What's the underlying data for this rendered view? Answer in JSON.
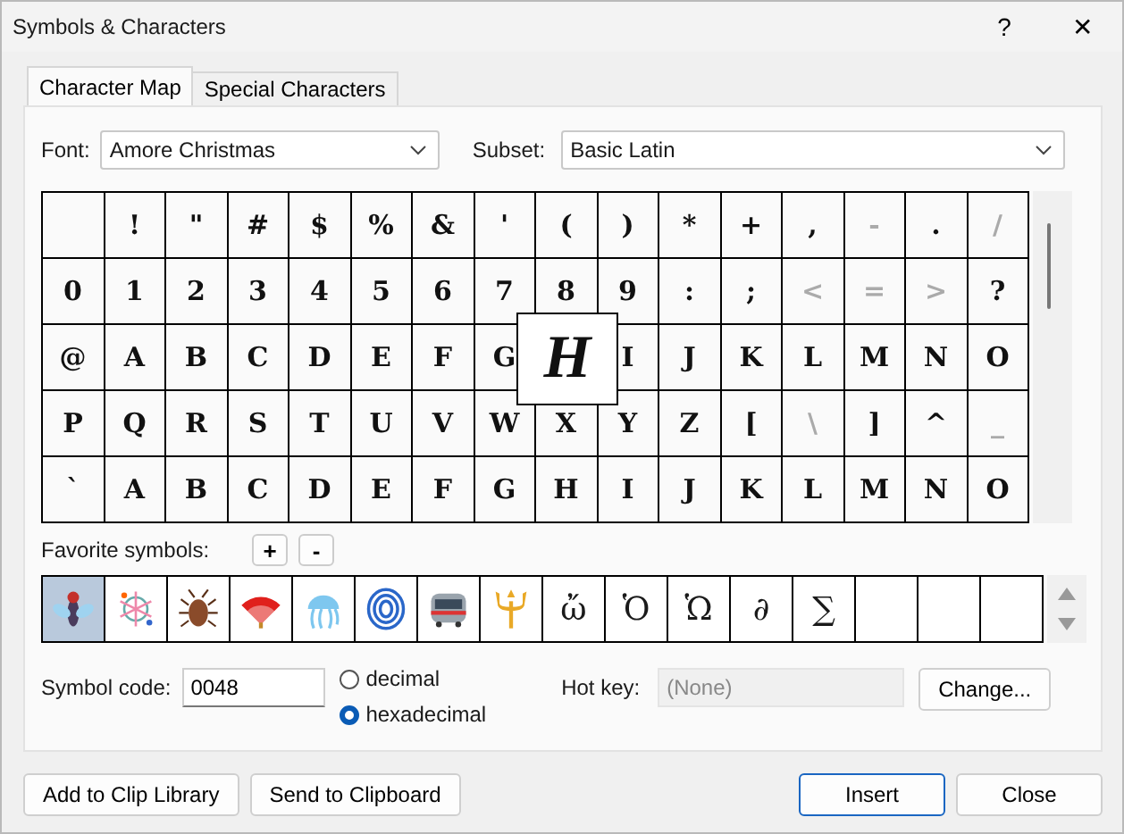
{
  "window": {
    "title": "Symbols & Characters",
    "help": "?",
    "close": "✕"
  },
  "tabs": [
    {
      "label": "Character Map",
      "selected": true
    },
    {
      "label": "Special Characters",
      "selected": false
    }
  ],
  "font": {
    "label": "Font:",
    "value": "Amore Christmas"
  },
  "subset": {
    "label": "Subset:",
    "value": "Basic Latin"
  },
  "grid": {
    "rows": [
      [
        " ",
        "!",
        "\"",
        "#",
        "$",
        "%",
        "&",
        "'",
        "(",
        ")",
        "*",
        "+",
        ",",
        {
          "text": "-",
          "faint": true
        },
        ".",
        {
          "text": "/",
          "faint": true
        }
      ],
      [
        "0",
        "1",
        "2",
        "3",
        "4",
        "5",
        "6",
        "7",
        "8",
        "9",
        ":",
        ";",
        {
          "text": "<",
          "faint": true
        },
        {
          "text": "=",
          "faint": true
        },
        {
          "text": ">",
          "faint": true
        },
        "?"
      ],
      [
        "@",
        "A",
        "B",
        "C",
        "D",
        "E",
        "F",
        "G",
        {
          "text": "H",
          "zoomed": true
        },
        "I",
        "J",
        "K",
        "L",
        "M",
        "N",
        "O"
      ],
      [
        "P",
        "Q",
        "R",
        "S",
        "T",
        "U",
        "V",
        "W",
        "X",
        "Y",
        "Z",
        "[",
        {
          "text": "\\",
          "faint": true
        },
        "]",
        "^",
        {
          "text": "_",
          "faint": true
        }
      ],
      [
        "`",
        "A",
        "B",
        "C",
        "D",
        "E",
        "F",
        "G",
        "H",
        "I",
        "J",
        "K",
        "L",
        "M",
        "N",
        "O"
      ]
    ]
  },
  "favorites": {
    "label": "Favorite symbols:",
    "add": "+",
    "remove": "-",
    "items": [
      {
        "kind": "icon",
        "selected": true
      },
      {
        "kind": "icon",
        "selected": false
      },
      {
        "kind": "icon",
        "selected": false
      },
      {
        "kind": "icon",
        "selected": false
      },
      {
        "kind": "icon",
        "selected": false
      },
      {
        "kind": "icon",
        "selected": false
      },
      {
        "kind": "icon",
        "selected": false
      },
      {
        "kind": "icon",
        "selected": false
      },
      {
        "kind": "text",
        "text": "ὤ",
        "selected": false
      },
      {
        "kind": "text",
        "text": "Ὁ",
        "selected": false
      },
      {
        "kind": "text",
        "text": "Ὡ",
        "selected": false
      },
      {
        "kind": "text",
        "text": "∂",
        "selected": false
      },
      {
        "kind": "text",
        "text": "∑",
        "selected": false
      },
      {
        "kind": "empty",
        "selected": false
      },
      {
        "kind": "empty",
        "selected": false
      },
      {
        "kind": "empty",
        "selected": false
      }
    ]
  },
  "symbol_code": {
    "label": "Symbol code:",
    "value": "0048"
  },
  "radix": [
    {
      "label": "decimal",
      "selected": false
    },
    {
      "label": "hexadecimal",
      "selected": true
    }
  ],
  "hot_key": {
    "label": "Hot key:",
    "placeholder": "(None)"
  },
  "change_button": "Change...",
  "buttons": [
    {
      "label": "Add to Clip Library",
      "primary": false
    },
    {
      "label": "Send to Clipboard",
      "primary": false
    },
    {
      "label": "Insert",
      "primary": true
    },
    {
      "label": "Close",
      "primary": false
    }
  ]
}
